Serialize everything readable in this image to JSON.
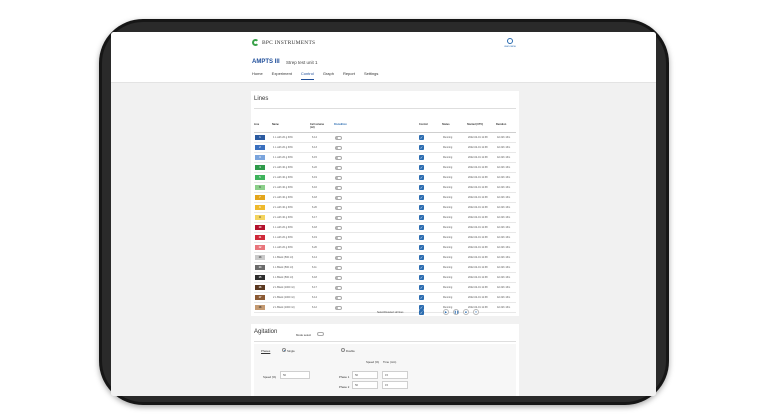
{
  "header": {
    "logo_text": "BPC INSTRUMENTS",
    "user_label": "user.name",
    "app_title": "AMPTS III",
    "app_subtitle": "Strep test unit 1",
    "tabs": [
      "Home",
      "Experiment",
      "Control",
      "Graph",
      "Report",
      "Settings"
    ],
    "active_tab": "Control"
  },
  "lines": {
    "title": "Lines",
    "columns": [
      "Line",
      "Name",
      "Cell volume (ml)",
      "Dis/edition",
      "Control",
      "Status",
      "Started (UTC)",
      "Duration"
    ],
    "rows": [
      {
        "line": "1",
        "color": "#2b5aa0",
        "name": "1 L with 20 g 30%",
        "vol": "6.14",
        "status": "Running",
        "started": "2022-02-01 11:38",
        "duration": "4d 22h 13m"
      },
      {
        "line": "2",
        "color": "#3a6fbe",
        "name": "1 L with 20 g 30%",
        "vol": "6.13",
        "status": "Running",
        "started": "2022-02-01 11:38",
        "duration": "4d 22h 13m"
      },
      {
        "line": "3",
        "color": "#7aa4dc",
        "name": "1 L with 20 g 30%",
        "vol": "6.15",
        "status": "Running",
        "started": "2022-02-01 11:38",
        "duration": "4d 22h 13m"
      },
      {
        "line": "4",
        "color": "#2f9a4a",
        "name": "2 L with 40 g 30%",
        "vol": "6.22",
        "status": "Running",
        "started": "2022-02-01 11:38",
        "duration": "4d 22h 13m"
      },
      {
        "line": "5",
        "color": "#3fb35c",
        "name": "2 L with 40 g 30%",
        "vol": "6.19",
        "status": "Running",
        "started": "2022-02-01 11:38",
        "duration": "4d 22h 13m"
      },
      {
        "line": "6",
        "color": "#8ccf8a",
        "name": "2 L with 40 g 30%",
        "vol": "6.16",
        "status": "Running",
        "started": "2022-02-01 11:38",
        "duration": "4d 22h 13m"
      },
      {
        "line": "7",
        "color": "#e3a51c",
        "name": "2 L with 40 g 30%",
        "vol": "6.18",
        "status": "Running",
        "started": "2022-02-01 11:38",
        "duration": "4d 22h 13m"
      },
      {
        "line": "8",
        "color": "#eeb92d",
        "name": "2 L with 40 g 30%",
        "vol": "6.20",
        "status": "Running",
        "started": "2022-02-01 11:38",
        "duration": "4d 22h 13m"
      },
      {
        "line": "9",
        "color": "#f3d35e",
        "name": "2 L with 40 g 30%",
        "vol": "6.17",
        "status": "Running",
        "started": "2022-02-01 11:38",
        "duration": "4d 22h 13m"
      },
      {
        "line": "10",
        "color": "#b3122e",
        "name": "1 L with 20 g 30%",
        "vol": "6.18",
        "status": "Running",
        "started": "2022-02-01 11:38",
        "duration": "4d 22h 13m"
      },
      {
        "line": "11",
        "color": "#cf2a3a",
        "name": "1 L with 20 g 30%",
        "vol": "6.19",
        "status": "Running",
        "started": "2022-02-01 11:38",
        "duration": "4d 22h 13m"
      },
      {
        "line": "12",
        "color": "#e8767c",
        "name": "1 L with 20 g 30%",
        "vol": "6.20",
        "status": "Running",
        "started": "2022-02-01 11:38",
        "duration": "4d 22h 13m"
      },
      {
        "line": "13",
        "color": "#c9c9c9",
        "name": "1 L Blank (500 ml)",
        "vol": "6.14",
        "status": "Running",
        "started": "2022-02-01 11:38",
        "duration": "4d 22h 13m"
      },
      {
        "line": "14",
        "color": "#6b6b6b",
        "name": "1 L Blank (500 ml)",
        "vol": "6.11",
        "status": "Running",
        "started": "2022-02-01 11:38",
        "duration": "4d 22h 13m"
      },
      {
        "line": "15",
        "color": "#2e2e2e",
        "name": "1 L Blank (500 ml)",
        "vol": "6.18",
        "status": "Running",
        "started": "2022-02-01 11:38",
        "duration": "4d 22h 13m"
      },
      {
        "line": "16",
        "color": "#5a3820",
        "name": "2 L Blank (1000 ml)",
        "vol": "6.17",
        "status": "Running",
        "started": "2022-02-01 11:38",
        "duration": "4d 22h 13m"
      },
      {
        "line": "17",
        "color": "#8b5a34",
        "name": "2 L Blank (1000 ml)",
        "vol": "6.14",
        "status": "Running",
        "started": "2022-02-01 11:38",
        "duration": "4d 22h 13m"
      },
      {
        "line": "18",
        "color": "#c49a72",
        "name": "2 L Blank (1000 ml)",
        "vol": "6.12",
        "status": "Running",
        "started": "2022-02-01 11:38",
        "duration": "4d 22h 13m"
      }
    ],
    "footer_label": "Select/Deselect all lines",
    "controls": [
      "▶",
      "❚❚",
      "■",
      "✕"
    ]
  },
  "agitation": {
    "title": "Agitation",
    "mode_label": "Mode select",
    "phases_label": "Phases",
    "single_label": "Single",
    "double_label": "Double",
    "speed_header": "Speed (%)",
    "time_header": "Time (min)",
    "speed_label": "Speed (%)",
    "speed_value": "50",
    "phase1_label": "Phase 1",
    "phase2_label": "Phase 2",
    "phase1_speed": "50",
    "phase1_time": "15",
    "phase2_speed": "50",
    "phase2_time": "15"
  }
}
